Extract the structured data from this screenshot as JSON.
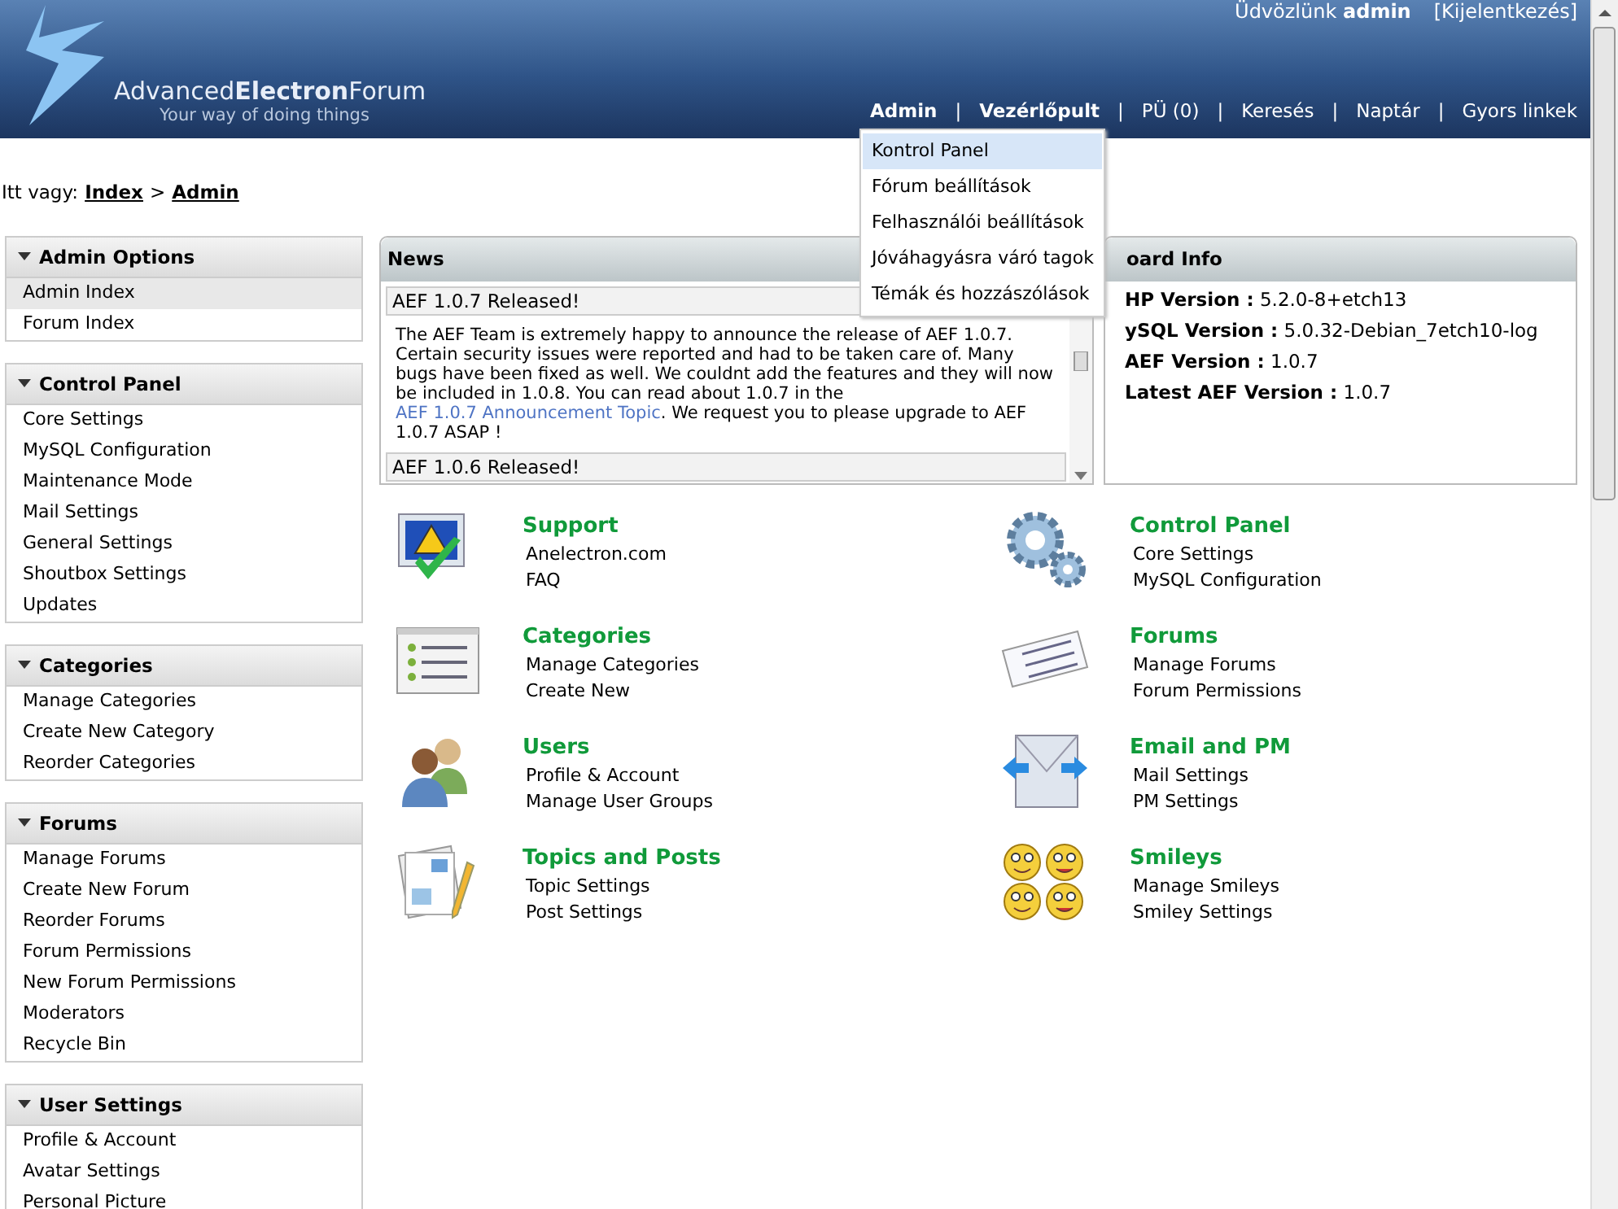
{
  "header": {
    "logo": {
      "parts": [
        "Advanced",
        "Electron",
        "Forum"
      ],
      "tagline": "Your way of doing things"
    },
    "welcome": {
      "text": "Üdvözlünk",
      "user": "admin"
    },
    "logout": "[Kijelentkezés]"
  },
  "nav": {
    "separator": "|",
    "items": [
      {
        "label": "Admin",
        "bold": true,
        "menu": [
          {
            "label": "Kontrol Panel",
            "selected": true
          },
          {
            "label": "Fórum beállítások",
            "selected": false
          },
          {
            "label": "Felhasználói beállítások",
            "selected": false
          },
          {
            "label": "Jóváhagyásra váró tagok",
            "selected": false
          },
          {
            "label": "Témák és hozzászólások",
            "selected": false
          }
        ]
      },
      {
        "label": "Vezérlőpult",
        "bold": true
      },
      {
        "label": "PÜ (0)",
        "bold": false
      },
      {
        "label": "Keresés",
        "bold": false
      },
      {
        "label": "Naptár",
        "bold": false
      },
      {
        "label": "Gyors linkek",
        "bold": false
      }
    ]
  },
  "breadcrumb": {
    "prefix": "Itt vagy:",
    "separator": ">",
    "items": [
      "Index",
      "Admin"
    ]
  },
  "sidebar": [
    {
      "title": "Admin Options",
      "expanded": true,
      "items": [
        {
          "label": "Admin Index",
          "selected": true
        },
        {
          "label": "Forum Index",
          "selected": false
        }
      ]
    },
    {
      "title": "Control Panel",
      "expanded": true,
      "items": [
        {
          "label": "Core Settings",
          "selected": false
        },
        {
          "label": "MySQL Configuration",
          "selected": false
        },
        {
          "label": "Maintenance Mode",
          "selected": false
        },
        {
          "label": "Mail Settings",
          "selected": false
        },
        {
          "label": "General Settings",
          "selected": false
        },
        {
          "label": "Shoutbox Settings",
          "selected": false
        },
        {
          "label": "Updates",
          "selected": false
        }
      ]
    },
    {
      "title": "Categories",
      "expanded": true,
      "items": [
        {
          "label": "Manage Categories",
          "selected": false
        },
        {
          "label": "Create New Category",
          "selected": false
        },
        {
          "label": "Reorder Categories",
          "selected": false
        }
      ]
    },
    {
      "title": "Forums",
      "expanded": true,
      "items": [
        {
          "label": "Manage Forums",
          "selected": false
        },
        {
          "label": "Create New Forum",
          "selected": false
        },
        {
          "label": "Reorder Forums",
          "selected": false
        },
        {
          "label": "Forum Permissions",
          "selected": false
        },
        {
          "label": "New Forum Permissions",
          "selected": false
        },
        {
          "label": "Moderators",
          "selected": false
        },
        {
          "label": "Recycle Bin",
          "selected": false
        }
      ]
    },
    {
      "title": "User Settings",
      "expanded": true,
      "items": [
        {
          "label": "Profile & Account",
          "selected": false
        },
        {
          "label": "Avatar Settings",
          "selected": false
        },
        {
          "label": "Personal Picture",
          "selected": false
        }
      ]
    }
  ],
  "news": {
    "title": "News",
    "items": [
      {
        "title": "AEF 1.0.7 Released!",
        "body_before": "The AEF Team is extremely happy to announce the release of AEF 1.0.7. Certain security issues were reported and had to be taken care of. Many bugs have been fixed as well. We couldnt add the features and they will now be included in 1.0.8. You can read about 1.0.7 in the ",
        "link": "AEF 1.0.7 Announcement Topic",
        "body_after": ". We request you to please upgrade to AEF 1.0.7 ASAP !"
      },
      {
        "title": "AEF 1.0.6 Released!"
      }
    ]
  },
  "board_info": {
    "title": "oard Info",
    "separator": ":",
    "rows": [
      {
        "label": "HP Version",
        "value": "5.2.0-8+etch13"
      },
      {
        "label": "ySQL Version",
        "value": "5.0.32-Debian_7etch10-log"
      },
      {
        "label": "AEF Version",
        "value": "1.0.7"
      },
      {
        "label": "Latest AEF Version",
        "value": "1.0.7"
      }
    ]
  },
  "shortcuts": [
    {
      "kind": "support",
      "title": "Support",
      "links": [
        "Anelectron.com",
        "FAQ"
      ]
    },
    {
      "kind": "gears",
      "title": "Control Panel",
      "links": [
        "Core Settings",
        "MySQL Configuration"
      ]
    },
    {
      "kind": "list",
      "title": "Categories",
      "links": [
        "Manage Categories",
        "Create New"
      ]
    },
    {
      "kind": "forums",
      "title": "Forums",
      "links": [
        "Manage Forums",
        "Forum Permissions"
      ]
    },
    {
      "kind": "users",
      "title": "Users",
      "links": [
        "Profile & Account",
        "Manage User Groups"
      ]
    },
    {
      "kind": "mail",
      "title": "Email and PM",
      "links": [
        "Mail Settings",
        "PM Settings"
      ]
    },
    {
      "kind": "posts",
      "title": "Topics and Posts",
      "links": [
        "Topic Settings",
        "Post Settings"
      ]
    },
    {
      "kind": "smileys",
      "title": "Smileys",
      "links": [
        "Manage Smileys",
        "Smiley Settings"
      ]
    }
  ]
}
